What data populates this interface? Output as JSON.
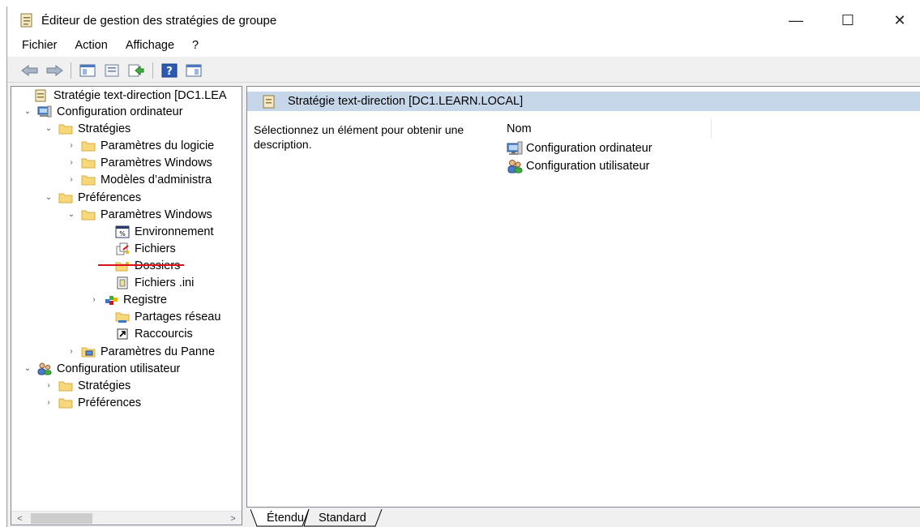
{
  "window": {
    "title": "Éditeur de gestion des stratégies de groupe",
    "controls": {
      "minimize": "—",
      "maximize": "☐",
      "close": "✕"
    }
  },
  "menu": [
    "Fichier",
    "Action",
    "Affichage",
    "?"
  ],
  "toolbar": {
    "buttons": [
      "back-icon",
      "forward-icon",
      "show-hide-tree-icon",
      "properties-icon",
      "export-list-icon",
      "help-icon",
      "action-pane-icon"
    ]
  },
  "tree": {
    "items": [
      {
        "label": "Stratégie text-direction [DC1.LEA",
        "icon": "policy-icon",
        "arrow": ""
      },
      {
        "label": "Configuration ordinateur",
        "icon": "computer-icon",
        "arrow": "⌄"
      },
      {
        "label": "Stratégies",
        "icon": "folder-icon",
        "arrow": "⌄"
      },
      {
        "label": "Paramètres du logicie",
        "icon": "folder-icon",
        "arrow": "›"
      },
      {
        "label": "Paramètres Windows",
        "icon": "folder-icon",
        "arrow": "›"
      },
      {
        "label": "Modèles d’administra",
        "icon": "folder-icon",
        "arrow": "›"
      },
      {
        "label": "Préférences",
        "icon": "folder-icon",
        "arrow": "⌄"
      },
      {
        "label": "Paramètres Windows",
        "icon": "folder-icon",
        "arrow": "⌄"
      },
      {
        "label": "Environnement",
        "icon": "environment-icon",
        "arrow": ""
      },
      {
        "label": "Fichiers",
        "icon": "files-icon",
        "arrow": ""
      },
      {
        "label": "Dossiers",
        "icon": "folders-icon",
        "arrow": ""
      },
      {
        "label": "Fichiers .ini",
        "icon": "ini-file-icon",
        "arrow": ""
      },
      {
        "label": "Registre",
        "icon": "registry-icon",
        "arrow": "›"
      },
      {
        "label": "Partages réseau",
        "icon": "network-share-icon",
        "arrow": ""
      },
      {
        "label": "Raccourcis",
        "icon": "shortcut-icon",
        "arrow": ""
      },
      {
        "label": "Paramètres du Panne",
        "icon": "control-panel-icon",
        "arrow": "›"
      },
      {
        "label": "Configuration utilisateur",
        "icon": "users-icon",
        "arrow": "⌄"
      },
      {
        "label": "Stratégies",
        "icon": "folder-icon",
        "arrow": "›"
      },
      {
        "label": "Préférences",
        "icon": "folder-icon",
        "arrow": "›"
      }
    ],
    "scroll": {
      "left": "<",
      "right": ">"
    }
  },
  "content": {
    "header": "Stratégie text-direction [DC1.LEARN.LOCAL]",
    "description": "Sélectionnez un élément pour obtenir une description.",
    "column": "Nom",
    "items": [
      {
        "label": "Configuration ordinateur",
        "icon": "computer-icon"
      },
      {
        "label": "Configuration utilisateur",
        "icon": "users-icon"
      }
    ]
  },
  "tabs": [
    {
      "label": "Étendu",
      "active": true
    },
    {
      "label": "Standard",
      "active": false
    }
  ],
  "colors": {
    "accent_header": "#c7d7ea",
    "folder": "#f6d77a",
    "annotation_line": "#d9121a"
  }
}
